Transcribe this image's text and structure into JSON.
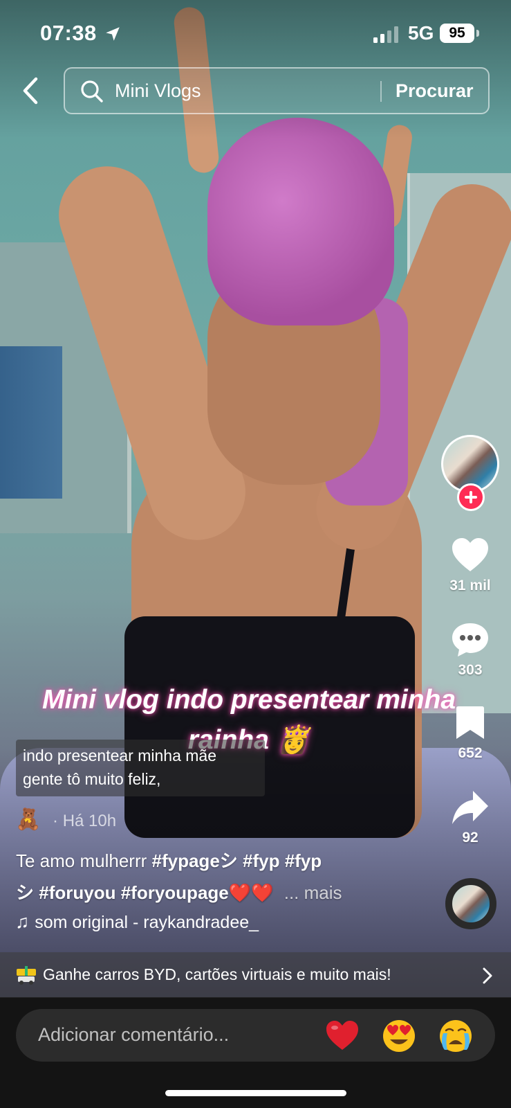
{
  "status_bar": {
    "time": "07:38",
    "network": "5G",
    "battery": "95"
  },
  "search": {
    "query": "Mini Vlogs",
    "button_label": "Procurar"
  },
  "video_overlay_text": "Mini vlog indo presentear minha rainha 👸",
  "actions": {
    "likes": "31 mil",
    "comments": "303",
    "saves": "652",
    "shares": "92"
  },
  "subtitle_lines": [
    "indo presentear minha mãe",
    "gente tô muito feliz,"
  ],
  "meta": {
    "author_emoji": "🧸",
    "posted": "· Há 10h"
  },
  "caption": {
    "text": "Te amo mulherrr",
    "hashtags": [
      "#fypageシ",
      "#fyp",
      "#fyp",
      "シ",
      "#foruyou",
      "#foryoupage❤️❤️"
    ],
    "more_label": "... mais"
  },
  "sound": {
    "icon": "music-note-icon",
    "label": "som original - raykandradee_"
  },
  "promo": {
    "text": "Ganhe carros BYD, cartões virtuais e muito mais!"
  },
  "comment_bar": {
    "placeholder": "Adicionar comentário...",
    "emojis": [
      "❤️",
      "😍",
      "😭"
    ]
  },
  "colors": {
    "accent": "#fe2c55",
    "bottom_bar": "#141414"
  }
}
